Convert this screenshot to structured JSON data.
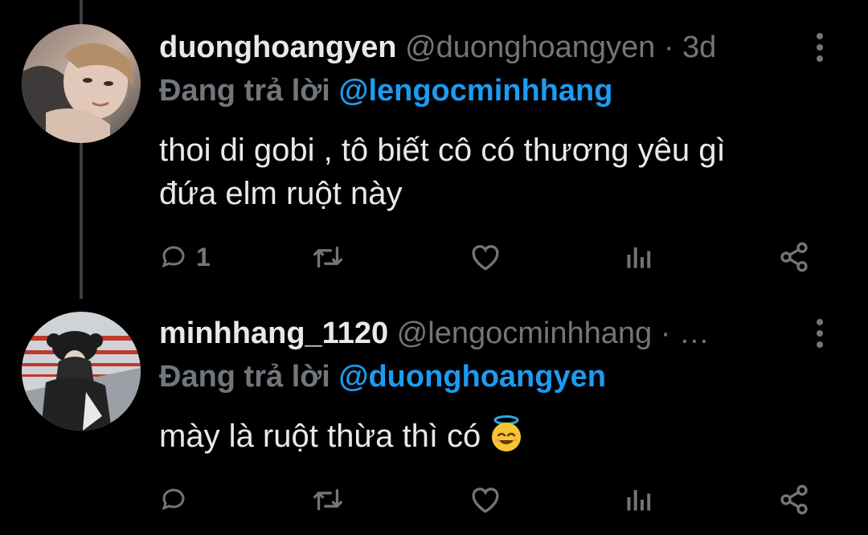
{
  "tweets": [
    {
      "display_name": "duonghoangyen",
      "handle_meta": " @duonghoangyen · 3d",
      "reply_prefix": "Đang trả lời",
      "reply_mention": "@lengocminhhang",
      "text_line1": "thoi di gobi , tô biết cô có thương yêu gì",
      "text_line2": "đứa elm ruột này",
      "reply_count": "1",
      "icons": [
        "reply-icon",
        "retweet-icon",
        "like-icon",
        "views-icon",
        "share-icon"
      ]
    },
    {
      "display_name": "minhhang_1120",
      "handle_meta": " @lengocminhhang · …",
      "reply_prefix": "Đang trả lời",
      "reply_mention": "@duonghoangyen",
      "text": "mày là ruột thừa thì có",
      "emoji": "smiling-face-with-halo",
      "reply_count": "",
      "icons": [
        "reply-icon",
        "retweet-icon",
        "like-icon",
        "views-icon",
        "share-icon"
      ]
    }
  ],
  "colors": {
    "background": "#000000",
    "text": "#e7e9ea",
    "muted": "#71767b",
    "mention": "#1d9bf0",
    "thread_line": "#3a3f44"
  }
}
